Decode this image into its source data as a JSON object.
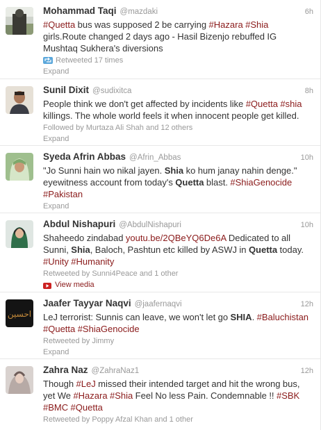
{
  "tweets": [
    {
      "fullname": "Mohammad Taqi",
      "username": "@mazdaki",
      "time": "6h",
      "text": [
        {
          "t": "#Quetta",
          "k": "ht"
        },
        {
          "t": " bus was supposed 2 be carrying ",
          "k": "tx"
        },
        {
          "t": "#Hazara",
          "k": "ht"
        },
        {
          "t": " ",
          "k": "tx"
        },
        {
          "t": "#Shia",
          "k": "ht"
        },
        {
          "t": " girls.Route changed 2 days ago - Hasil Bizenjo rebuffed IG Mushtaq Sukhera's diversions",
          "k": "tx"
        }
      ],
      "meta": "Retweeted 17 times",
      "action": "Expand"
    },
    {
      "fullname": "Sunil Dixit",
      "username": "@sudixitca",
      "time": "8h",
      "text": [
        {
          "t": "People think we don't get affected by incidents like ",
          "k": "tx"
        },
        {
          "t": "#Quetta",
          "k": "ht"
        },
        {
          "t": " ",
          "k": "tx"
        },
        {
          "t": "#shia",
          "k": "ht"
        },
        {
          "t": " killings. The whole world feels it when innocent people get killed.",
          "k": "tx"
        }
      ],
      "meta": "Followed by Murtaza Ali Shah and 12 others",
      "action": "Expand"
    },
    {
      "fullname": "Syeda Afrin Abbas",
      "username": "@Afrin_Abbas",
      "time": "10h",
      "text": [
        {
          "t": "\"Jo Sunni hain wo nikal jayen. ",
          "k": "tx"
        },
        {
          "t": "Shia",
          "k": "b"
        },
        {
          "t": " ko hum janay nahin denge.\" eyewitness account from today's ",
          "k": "tx"
        },
        {
          "t": "Quetta",
          "k": "b"
        },
        {
          "t": " blast. ",
          "k": "tx"
        },
        {
          "t": "#ShiaGenocide",
          "k": "ht"
        },
        {
          "t": " ",
          "k": "tx"
        },
        {
          "t": "#Pakistan",
          "k": "ht"
        }
      ],
      "meta": "",
      "action": "Expand"
    },
    {
      "fullname": "Abdul Nishapuri",
      "username": "@AbdulNishapuri",
      "time": "10h",
      "text": [
        {
          "t": "Shaheedo zindabad ",
          "k": "tx"
        },
        {
          "t": "youtu.be/2QBeYQ6De6A",
          "k": "ln"
        },
        {
          "t": " Dedicated to all Sunni, ",
          "k": "tx"
        },
        {
          "t": "Shia",
          "k": "b"
        },
        {
          "t": ", Baloch, Pashtun etc killed by ASWJ in ",
          "k": "tx"
        },
        {
          "t": "Quetta",
          "k": "b"
        },
        {
          "t": " today. ",
          "k": "tx"
        },
        {
          "t": "#Unity",
          "k": "ht"
        },
        {
          "t": " ",
          "k": "tx"
        },
        {
          "t": "#Humanity",
          "k": "ht"
        }
      ],
      "meta": "Retweeted by Sunni4Peace and 1 other",
      "action": "View media"
    },
    {
      "fullname": "Jaafer Tayyar Naqvi",
      "username": "@jaafernaqvi",
      "time": "12h",
      "text": [
        {
          "t": "LeJ terrorist: Sunnis can leave, we won't let go ",
          "k": "tx"
        },
        {
          "t": "SHIA",
          "k": "b"
        },
        {
          "t": ". ",
          "k": "tx"
        },
        {
          "t": "#Baluchistan",
          "k": "ht"
        },
        {
          "t": " ",
          "k": "tx"
        },
        {
          "t": "#Quetta",
          "k": "ht"
        },
        {
          "t": " ",
          "k": "tx"
        },
        {
          "t": "#ShiaGenocide",
          "k": "ht"
        }
      ],
      "meta": "Retweeted by Jimmy",
      "action": "Expand",
      "avatar_text": "احسین"
    },
    {
      "fullname": "Zahra Naz",
      "username": "@ZahraNaz1",
      "time": "12h",
      "text": [
        {
          "t": "Though ",
          "k": "tx"
        },
        {
          "t": "#LeJ",
          "k": "ht"
        },
        {
          "t": " missed their intended target and hit the wrong bus, yet We ",
          "k": "tx"
        },
        {
          "t": "#Hazara",
          "k": "ht"
        },
        {
          "t": " ",
          "k": "tx"
        },
        {
          "t": "#Shia",
          "k": "ht"
        },
        {
          "t": " Feel No less Pain. Condemnable !! ",
          "k": "tx"
        },
        {
          "t": "#SBK",
          "k": "ht"
        },
        {
          "t": " ",
          "k": "tx"
        },
        {
          "t": "#BMC",
          "k": "ht"
        },
        {
          "t": " ",
          "k": "tx"
        },
        {
          "t": "#Quetta",
          "k": "ht"
        }
      ],
      "meta": "Retweeted by Poppy Afzal Khan and 1 other",
      "action": ""
    }
  ],
  "colors": {
    "hashtag": "#8a1a1a",
    "muted": "#999999",
    "text": "#333333",
    "retweet_icon": "#5aa7db",
    "media_icon": "#cc2222"
  },
  "icons": {
    "retweet": "retweet-icon",
    "media": "play-icon"
  }
}
